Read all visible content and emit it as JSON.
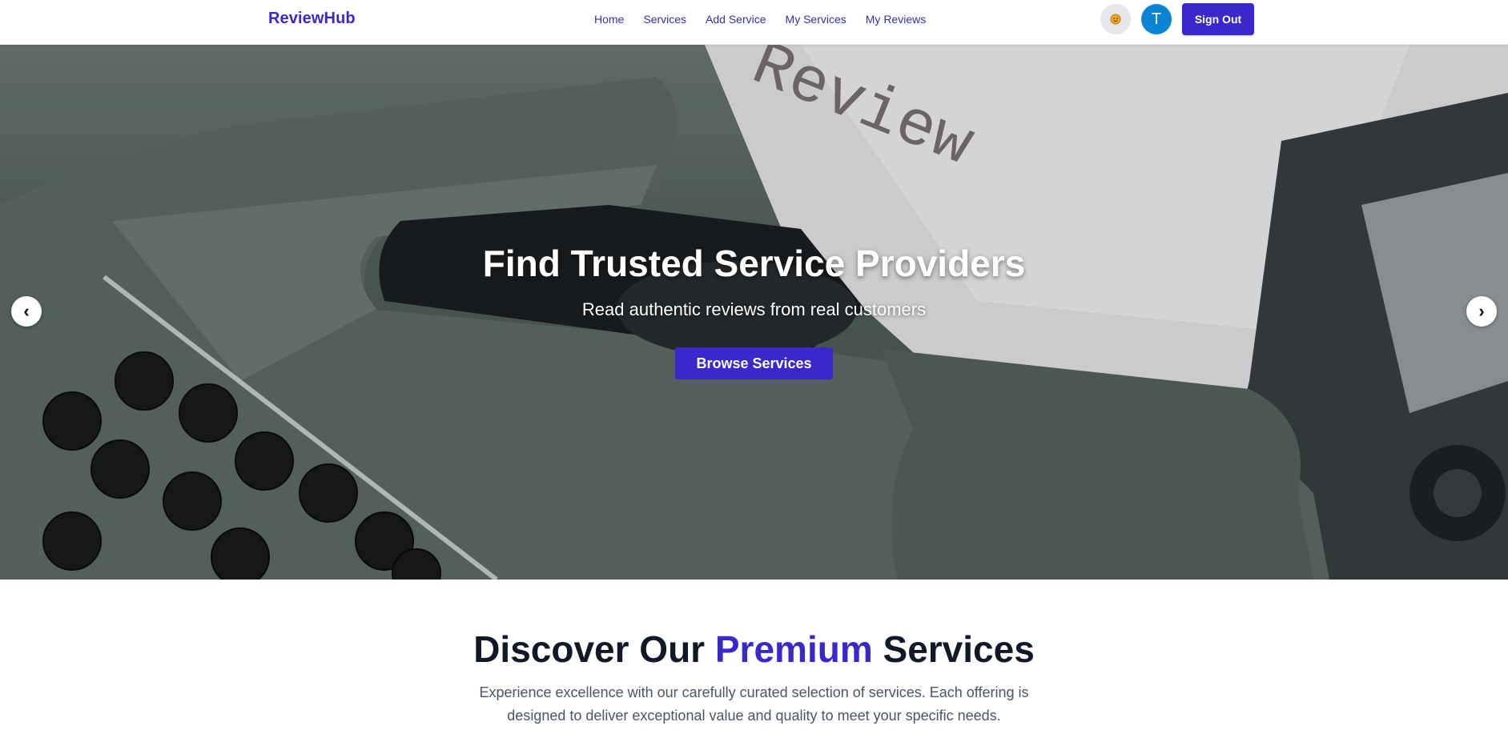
{
  "navbar": {
    "brand": "ReviewHub",
    "links": [
      "Home",
      "Services",
      "Add Service",
      "My Services",
      "My Reviews"
    ],
    "theme_icon": "sun-face-icon",
    "avatar_letter": "T",
    "signout_label": "Sign Out"
  },
  "hero": {
    "title": "Find Trusted Service Providers",
    "subtitle": "Read authentic reviews from real customers",
    "cta_label": "Browse Services",
    "paper_text": "Review",
    "prev_label": "‹",
    "next_label": "›"
  },
  "section": {
    "title_part1": "Discover Our ",
    "title_accent": "Premium",
    "title_part2": " Services",
    "description": "Experience excellence with our carefully curated selection of services. Each offering is designed to deliver exceptional value and quality to meet your specific needs."
  },
  "colors": {
    "brand": "#3b28cc",
    "avatar": "#0a84d6"
  }
}
